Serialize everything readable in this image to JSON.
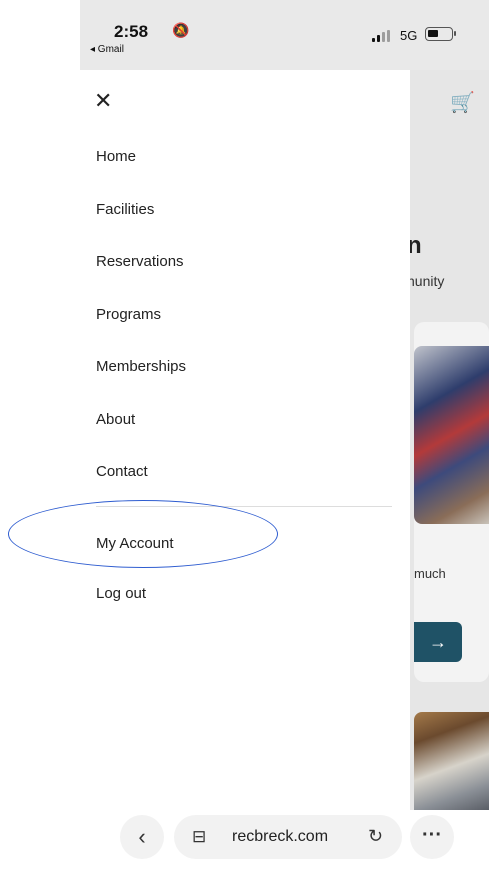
{
  "status_bar": {
    "time": "2:58",
    "back_app": "◂ Gmail",
    "network": "5G"
  },
  "drawer": {
    "close_glyph": "✕",
    "items": [
      {
        "label": "Home"
      },
      {
        "label": "Facilities"
      },
      {
        "label": "Reservations"
      },
      {
        "label": "Programs"
      },
      {
        "label": "Memberships"
      },
      {
        "label": "About"
      },
      {
        "label": "Contact"
      },
      {
        "label": "My Account"
      },
      {
        "label": "Log out"
      }
    ]
  },
  "background_page": {
    "heading_fragment": "n",
    "subtext_fragment": "nunity",
    "card_text_fragment": "much",
    "arrow_glyph": "→",
    "cart_icon": "cart-icon"
  },
  "browser_bar": {
    "back_glyph": "‹",
    "url": "recbreck.com",
    "tab_glyph": "⊟",
    "reload_glyph": "↻",
    "more_glyph": "···"
  },
  "colors": {
    "accent_button": "#1f5266",
    "annotation_oval": "#2f5dd0"
  }
}
